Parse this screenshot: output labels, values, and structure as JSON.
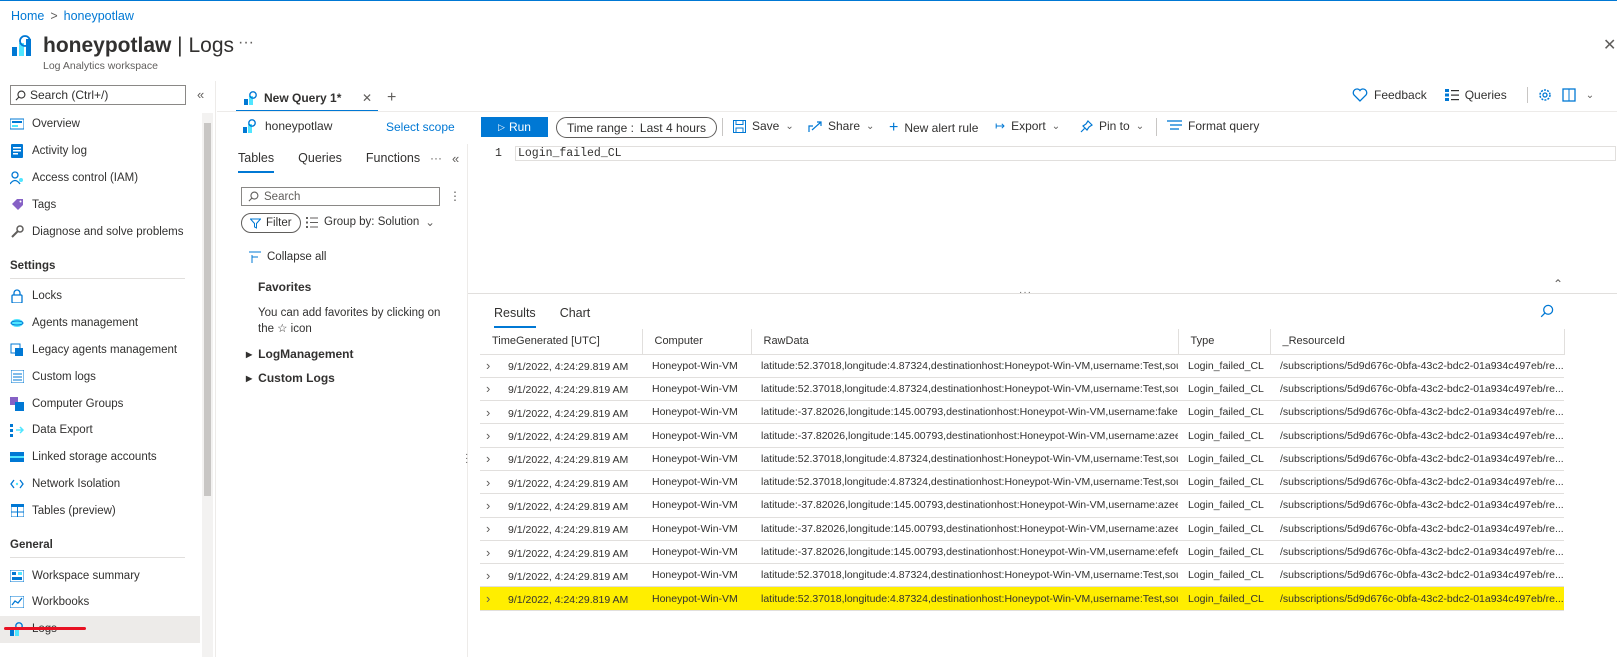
{
  "breadcrumb": {
    "home": "Home",
    "current": "honeypotlaw"
  },
  "header": {
    "resource": "honeypotlaw",
    "separator": " | ",
    "blade": "Logs",
    "subtitle": "Log Analytics workspace"
  },
  "sidebar": {
    "search_placeholder": "Search (Ctrl+/)",
    "top_items": [
      {
        "label": "Overview"
      },
      {
        "label": "Activity log"
      },
      {
        "label": "Access control (IAM)"
      },
      {
        "label": "Tags"
      },
      {
        "label": "Diagnose and solve problems"
      }
    ],
    "settings_heading": "Settings",
    "settings_items": [
      {
        "label": "Locks"
      },
      {
        "label": "Agents management"
      },
      {
        "label": "Legacy agents management"
      },
      {
        "label": "Custom logs"
      },
      {
        "label": "Computer Groups"
      },
      {
        "label": "Data Export"
      },
      {
        "label": "Linked storage accounts"
      },
      {
        "label": "Network Isolation"
      },
      {
        "label": "Tables (preview)"
      }
    ],
    "general_heading": "General",
    "general_items": [
      {
        "label": "Workspace summary"
      },
      {
        "label": "Workbooks"
      },
      {
        "label": "Logs"
      }
    ]
  },
  "query_tab": {
    "label": "New Query 1*"
  },
  "top_right": {
    "feedback": "Feedback",
    "queries": "Queries"
  },
  "toolbar": {
    "scope": "honeypotlaw",
    "select_scope": "Select scope",
    "run": "Run",
    "time_range_label": "Time range :",
    "time_range_value": "Last 4 hours",
    "save": "Save",
    "share": "Share",
    "new_alert_rule": "New alert rule",
    "export": "Export",
    "pin_to": "Pin to",
    "format_query": "Format query"
  },
  "left_pane": {
    "tabs": [
      "Tables",
      "Queries",
      "Functions"
    ],
    "search_placeholder": "Search",
    "filter": "Filter",
    "group_by": "Group by: Solution",
    "collapse_all": "Collapse all",
    "favorites_title": "Favorites",
    "favorites_text": "You can add favorites by clicking on the ☆ icon",
    "tree": [
      "LogManagement",
      "Custom Logs"
    ]
  },
  "editor": {
    "line_number": "1",
    "query": "Login_failed_CL"
  },
  "results": {
    "tabs": [
      "Results",
      "Chart"
    ],
    "columns": [
      "TimeGenerated [UTC]",
      "Computer",
      "RawData",
      "Type",
      "_ResourceId"
    ],
    "rows": [
      [
        "9/1/2022, 4:24:29.819 AM",
        "Honeypot-Win-VM",
        "latitude:52.37018,longitude:4.87324,destinationhost:Honeypot-Win-VM,username:Test,sou...",
        "Login_failed_CL",
        "/subscriptions/5d9d676c-0bfa-43c2-bdc2-01a934c497eb/re..."
      ],
      [
        "9/1/2022, 4:24:29.819 AM",
        "Honeypot-Win-VM",
        "latitude:52.37018,longitude:4.87324,destinationhost:Honeypot-Win-VM,username:Test,sou...",
        "Login_failed_CL",
        "/subscriptions/5d9d676c-0bfa-43c2-bdc2-01a934c497eb/re..."
      ],
      [
        "9/1/2022, 4:24:29.819 AM",
        "Honeypot-Win-VM",
        "latitude:-37.82026,longitude:145.00793,destinationhost:Honeypot-Win-VM,username:fake...",
        "Login_failed_CL",
        "/subscriptions/5d9d676c-0bfa-43c2-bdc2-01a934c497eb/re..."
      ],
      [
        "9/1/2022, 4:24:29.819 AM",
        "Honeypot-Win-VM",
        "latitude:-37.82026,longitude:145.00793,destinationhost:Honeypot-Win-VM,username:azee...",
        "Login_failed_CL",
        "/subscriptions/5d9d676c-0bfa-43c2-bdc2-01a934c497eb/re..."
      ],
      [
        "9/1/2022, 4:24:29.819 AM",
        "Honeypot-Win-VM",
        "latitude:52.37018,longitude:4.87324,destinationhost:Honeypot-Win-VM,username:Test,sou...",
        "Login_failed_CL",
        "/subscriptions/5d9d676c-0bfa-43c2-bdc2-01a934c497eb/re..."
      ],
      [
        "9/1/2022, 4:24:29.819 AM",
        "Honeypot-Win-VM",
        "latitude:52.37018,longitude:4.87324,destinationhost:Honeypot-Win-VM,username:Test,sou...",
        "Login_failed_CL",
        "/subscriptions/5d9d676c-0bfa-43c2-bdc2-01a934c497eb/re..."
      ],
      [
        "9/1/2022, 4:24:29.819 AM",
        "Honeypot-Win-VM",
        "latitude:-37.82026,longitude:145.00793,destinationhost:Honeypot-Win-VM,username:azee...",
        "Login_failed_CL",
        "/subscriptions/5d9d676c-0bfa-43c2-bdc2-01a934c497eb/re..."
      ],
      [
        "9/1/2022, 4:24:29.819 AM",
        "Honeypot-Win-VM",
        "latitude:-37.82026,longitude:145.00793,destinationhost:Honeypot-Win-VM,username:azee...",
        "Login_failed_CL",
        "/subscriptions/5d9d676c-0bfa-43c2-bdc2-01a934c497eb/re..."
      ],
      [
        "9/1/2022, 4:24:29.819 AM",
        "Honeypot-Win-VM",
        "latitude:-37.82026,longitude:145.00793,destinationhost:Honeypot-Win-VM,username:efefe...",
        "Login_failed_CL",
        "/subscriptions/5d9d676c-0bfa-43c2-bdc2-01a934c497eb/re..."
      ],
      [
        "9/1/2022, 4:24:29.819 AM",
        "Honeypot-Win-VM",
        "latitude:52.37018,longitude:4.87324,destinationhost:Honeypot-Win-VM,username:Test,sou...",
        "Login_failed_CL",
        "/subscriptions/5d9d676c-0bfa-43c2-bdc2-01a934c497eb/re..."
      ],
      [
        "9/1/2022, 4:24:29.819 AM",
        "Honeypot-Win-VM",
        "latitude:52.37018,longitude:4.87324,destinationhost:Honeypot-Win-VM,username:Test,sou...",
        "Login_failed_CL",
        "/subscriptions/5d9d676c-0bfa-43c2-bdc2-01a934c497eb/re..."
      ]
    ],
    "highlighted_row_index": 10
  },
  "colors": {
    "accent": "#0078d4",
    "highlight": "#ffee00",
    "active_underline": "#e81123"
  }
}
